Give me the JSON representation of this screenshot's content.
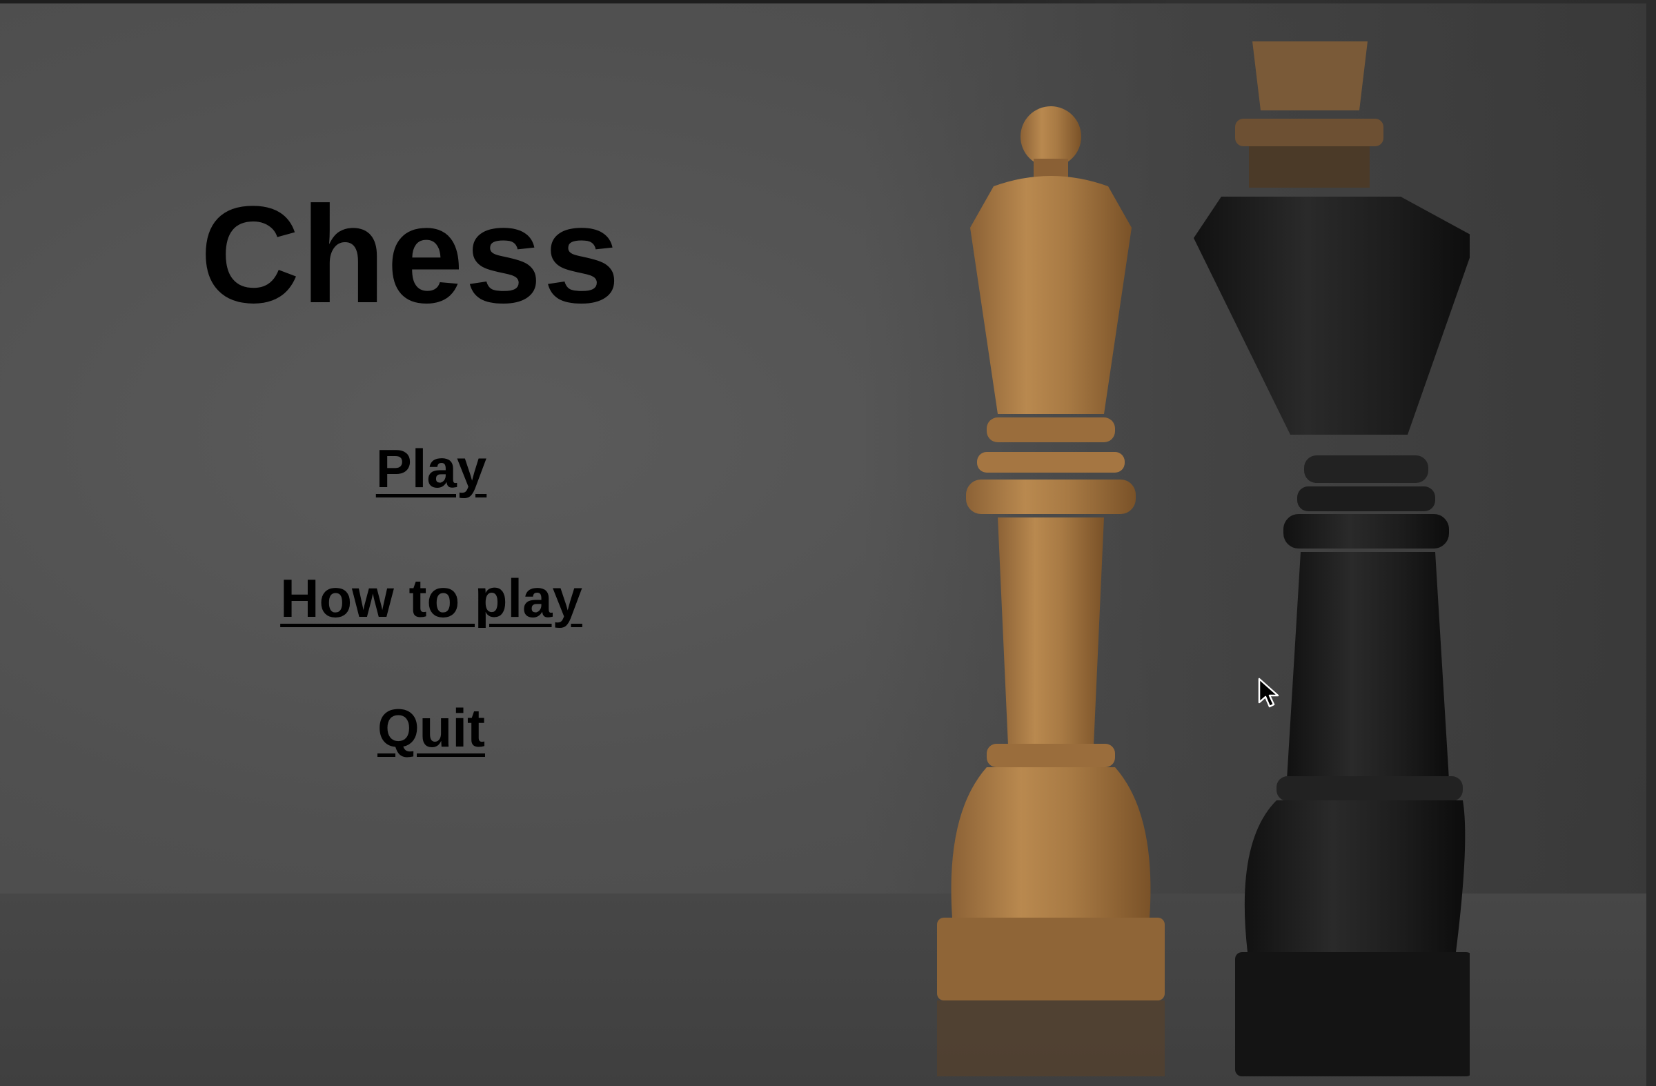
{
  "game": {
    "title": "Chess"
  },
  "menu": {
    "items": [
      {
        "label": "Play"
      },
      {
        "label": "How to play"
      },
      {
        "label": "Quit"
      }
    ]
  },
  "theme": {
    "background": "#515151",
    "text": "#000000",
    "white_piece": "#b8874f",
    "black_piece": "#1c1c1c"
  }
}
